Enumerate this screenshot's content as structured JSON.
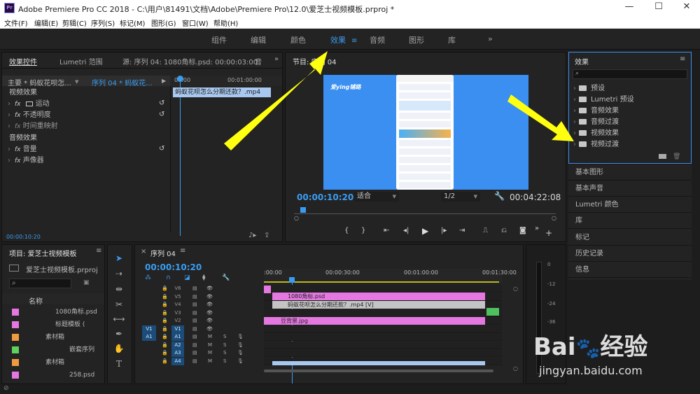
{
  "window": {
    "title": "Adobe Premiere Pro CC 2018 - C:\\用户\\81491\\文档\\Adobe\\Premiere Pro\\12.0\\爱芝士视频模板.prproj *",
    "app_icon": "Pr",
    "minimize": "—",
    "maximize": "☐",
    "close": "✕"
  },
  "menu": [
    "文件(F)",
    "编辑(E)",
    "剪辑(C)",
    "序列(S)",
    "标记(M)",
    "图形(G)",
    "窗口(W)",
    "帮助(H)"
  ],
  "workspaces": [
    "组件",
    "编辑",
    "颜色",
    "效果",
    "音频",
    "图形",
    "库"
  ],
  "workspace_more": "»",
  "effect_controls": {
    "tabs": [
      "效果控件",
      "Lumetri 范围",
      "源: 序列 04: 1080角标.psd: 00:00:03:00",
      "音"
    ],
    "master": "主要 * 蚂蚁花呗怎...",
    "sequence": "序列 04 * 蚂蚁花...",
    "ruler": [
      "00:00",
      "00:01:00:00"
    ],
    "clip_label": "蚂蚁花呗怎么分期还款？.mp4",
    "rows": [
      {
        "label": "视频效果",
        "type": "section"
      },
      {
        "label": "运动",
        "type": "fx"
      },
      {
        "label": "不透明度",
        "type": "fx"
      },
      {
        "label": "时间重映射",
        "type": "fx"
      },
      {
        "label": "音频效果",
        "type": "section"
      },
      {
        "label": "音量",
        "type": "fx"
      },
      {
        "label": "声像器",
        "type": "fx"
      }
    ],
    "timecode": "00:00:10:20"
  },
  "program": {
    "tab": "节目: 序列 04",
    "timecode": "00:00:10:20",
    "fit": "适合",
    "ratio": "1/2",
    "duration": "00:04:22:08",
    "watermark": "爱ying铺路"
  },
  "effects": {
    "title": "效果",
    "items": [
      "预设",
      "Lumetri 预设",
      "音频效果",
      "音频过渡",
      "视频效果",
      "视频过渡"
    ],
    "side": [
      "基本图形",
      "基本声音",
      "Lumetri 颜色",
      "库",
      "标记",
      "历史记录",
      "信息"
    ]
  },
  "project": {
    "title": "项目: 爱芝士视频模板",
    "file": "爱芝士视频模板.prproj",
    "col": "名称",
    "items": [
      {
        "name": "1080角标.psd",
        "color": "#e478e0",
        "indent": 40
      },
      {
        "name": "标题模板 (",
        "color": "#e478e0",
        "indent": 40
      },
      {
        "name": "素材箱",
        "color": "#f09a40",
        "indent": 26
      },
      {
        "name": "嵌套序列",
        "color": "#5fcf5f",
        "indent": 60
      },
      {
        "name": "素材箱",
        "color": "#f09a40",
        "indent": 26
      },
      {
        "name": "258.psd",
        "color": "#e478e0",
        "indent": 60
      }
    ]
  },
  "timeline": {
    "tab": "序列 04",
    "timecode": "00:00:10:20",
    "ruler": [
      ":00:00",
      "00:00:30:00",
      "00:01:00:00",
      "00:01:30:00"
    ],
    "video_tracks": [
      "V6",
      "V5",
      "V4",
      "V3",
      "V2",
      "V1"
    ],
    "audio_tracks": [
      "A1",
      "A2",
      "A3",
      "A4"
    ],
    "src_v": "V1",
    "src_a": "A1",
    "clips": {
      "v5": "1080角标.psd",
      "v4": "蚂蚁花呗怎么分期还款？.mp4 [V]",
      "v2": "豆背景.jpg"
    },
    "mute": "M",
    "solo": "S"
  },
  "meter": {
    "labels": [
      "0",
      "-12",
      "-24",
      "-36"
    ]
  },
  "watermark": {
    "brand": "Bai",
    "brand2": "经验",
    "url": "jingyan.baidu.com"
  }
}
